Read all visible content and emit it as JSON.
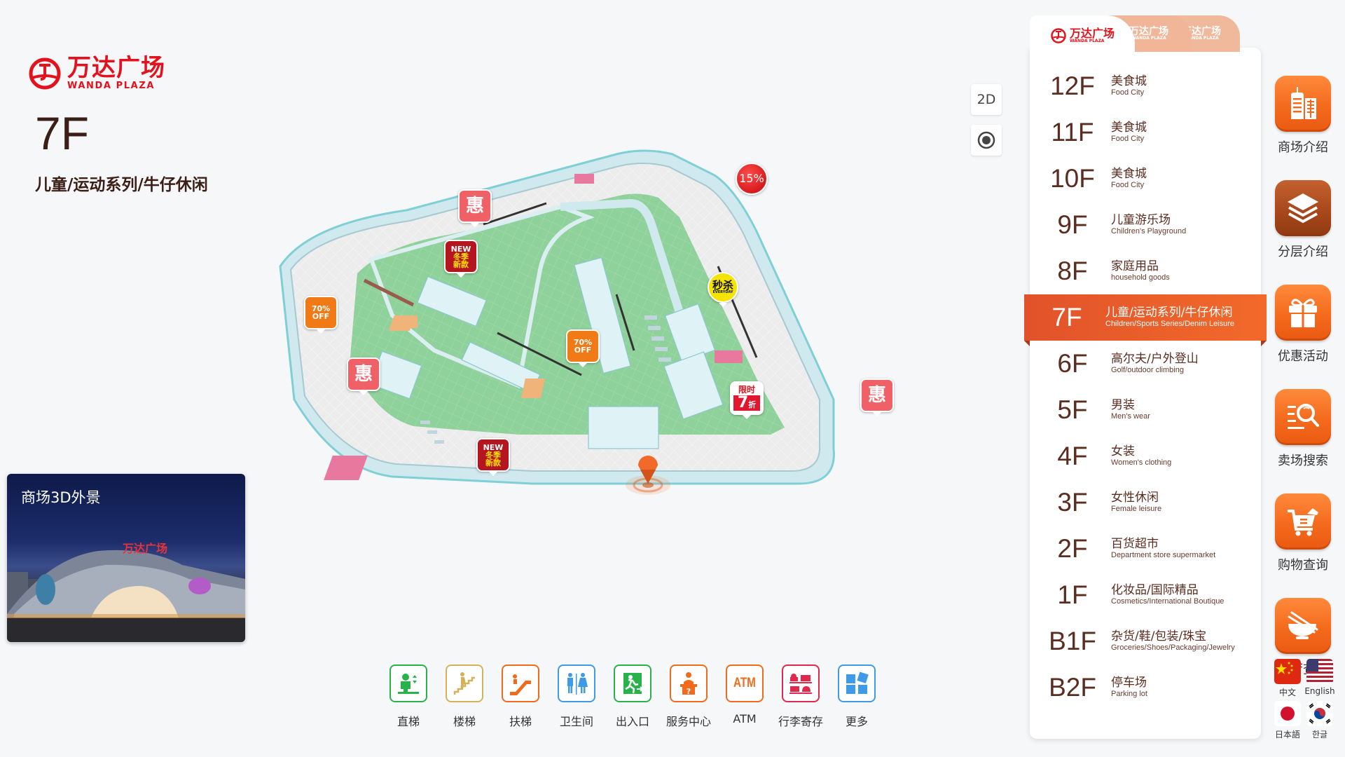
{
  "brand": {
    "name_cn": "万达广场",
    "name_en": "WANDA PLAZA",
    "color": "#e3121d"
  },
  "current_floor": {
    "code": "7F",
    "description": "儿童/运动系列/牛仔休闲"
  },
  "exterior_card": {
    "title": "商场3D外景",
    "sign_text": "万达广场"
  },
  "view_controls": {
    "mode_label": "2D",
    "locate_icon": "target-icon"
  },
  "facilities": [
    {
      "label": "直梯",
      "icon": "elevator-icon",
      "color": "#27b24a"
    },
    {
      "label": "楼梯",
      "icon": "stairs-icon",
      "color": "#d4b25a"
    },
    {
      "label": "扶梯",
      "icon": "escalator-icon",
      "color": "#f06b1c"
    },
    {
      "label": "卫生间",
      "icon": "restroom-icon",
      "color": "#3f9ae8"
    },
    {
      "label": "出入口",
      "icon": "exit-icon",
      "color": "#27b24a"
    },
    {
      "label": "服务中心",
      "icon": "service-desk-icon",
      "color": "#f06b1c"
    },
    {
      "label": "ATM",
      "icon": "atm-icon",
      "color": "#f06b1c",
      "icon_text": "ATM"
    },
    {
      "label": "行李寄存",
      "icon": "luggage-icon",
      "color": "#e0294f"
    },
    {
      "label": "更多",
      "icon": "more-grid-icon",
      "color": "#3f9ae8"
    }
  ],
  "floor_panel": {
    "tabs": [
      {
        "label_cn": "万达广场",
        "label_en": "WANDA PLAZA",
        "active": true
      },
      {
        "label_cn": "万达广场",
        "label_en": "WANDA PLAZA",
        "active": false
      },
      {
        "label_cn": "万达广场",
        "label_en": "WANDA PLAZA",
        "active": false
      }
    ],
    "floors": [
      {
        "code": "12F",
        "name_cn": "美食城",
        "name_en": "Food City"
      },
      {
        "code": "11F",
        "name_cn": "美食城",
        "name_en": "Food City"
      },
      {
        "code": "10F",
        "name_cn": "美食城",
        "name_en": "Food City"
      },
      {
        "code": "9F",
        "name_cn": "儿童游乐场",
        "name_en": "Children's Playground"
      },
      {
        "code": "8F",
        "name_cn": "家庭用品",
        "name_en": "household goods"
      },
      {
        "code": "7F",
        "name_cn": "儿童/运动系列/牛仔休闲",
        "name_en": "Children/Sports Series/Denim Leisure",
        "active": true
      },
      {
        "code": "6F",
        "name_cn": "高尔夫/户外登山",
        "name_en": "Golf/outdoor climbing"
      },
      {
        "code": "5F",
        "name_cn": "男装",
        "name_en": "Men's wear"
      },
      {
        "code": "4F",
        "name_cn": "女装",
        "name_en": "Women's clothing"
      },
      {
        "code": "3F",
        "name_cn": "女性休闲",
        "name_en": "Female leisure"
      },
      {
        "code": "2F",
        "name_cn": "百货超市",
        "name_en": "Department store supermarket"
      },
      {
        "code": "1F",
        "name_cn": "化妆品/国际精品",
        "name_en": "Cosmetics/International Boutique"
      },
      {
        "code": "B1F",
        "name_cn": "杂货/鞋/包装/珠宝",
        "name_en": "Groceries/Shoes/Packaging/Jewelry"
      },
      {
        "code": "B2F",
        "name_cn": "停车场",
        "name_en": "Parking lot"
      }
    ]
  },
  "side_actions": [
    {
      "label": "商场介绍",
      "icon": "building-icon"
    },
    {
      "label": "分层介绍",
      "icon": "layers-icon",
      "active": true
    },
    {
      "label": "优惠活动",
      "icon": "gift-icon"
    },
    {
      "label": "卖场搜索",
      "icon": "search-list-icon"
    },
    {
      "label": "购物查询",
      "icon": "shopping-cart-icon"
    },
    {
      "label": "餐厅查询",
      "icon": "bowl-chopsticks-icon"
    }
  ],
  "languages": [
    {
      "label": "中文",
      "icon": "china-flag-icon"
    },
    {
      "label": "English",
      "icon": "usa-flag-icon"
    },
    {
      "label": "日本語",
      "icon": "japan-flag-icon"
    },
    {
      "label": "한글",
      "icon": "korea-flag-icon"
    }
  ],
  "map_markers": {
    "discount_hui": "惠",
    "off_line1": "70%",
    "off_line2": "OFF",
    "new_line1": "NEW",
    "new_line2": "冬季",
    "new_line3": "新款",
    "limit_line1": "限时",
    "limit_num": "7",
    "limit_unit": "折",
    "percent": "15%",
    "flash_sale": "秒杀",
    "flash_sale_sub": "EVERYDAY"
  },
  "colors": {
    "accent": "#f26a2a",
    "active_floor": "#e2522a",
    "floor_text": "#5b2c20",
    "map_floor": "#8fd19a"
  }
}
